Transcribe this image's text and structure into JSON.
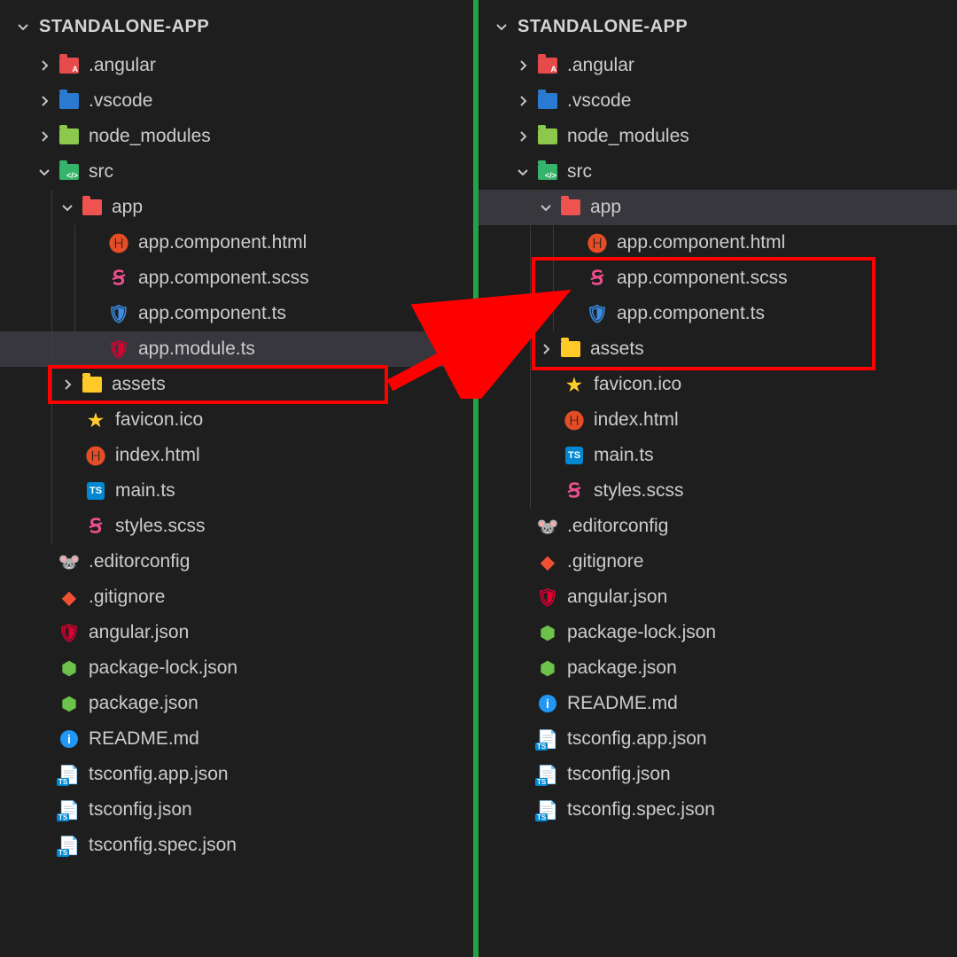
{
  "left": {
    "root": "STANDALONE-APP",
    "items": {
      "angular": ".angular",
      "vscode": ".vscode",
      "node": "node_modules",
      "src": "src",
      "app": "app",
      "comp_html": "app.component.html",
      "comp_scss": "app.component.scss",
      "comp_ts": "app.component.ts",
      "module_ts": "app.module.ts",
      "assets": "assets",
      "favicon": "favicon.ico",
      "index": "index.html",
      "main": "main.ts",
      "styles": "styles.scss",
      "editcfg": ".editorconfig",
      "gitignore": ".gitignore",
      "angjson": "angular.json",
      "pkglock": "package-lock.json",
      "pkg": "package.json",
      "readme": "README.md",
      "tscfgapp": "tsconfig.app.json",
      "tscfg": "tsconfig.json",
      "tscfgspec": "tsconfig.spec.json"
    }
  },
  "right": {
    "root": "STANDALONE-APP",
    "items": {
      "angular": ".angular",
      "vscode": ".vscode",
      "node": "node_modules",
      "src": "src",
      "app": "app",
      "comp_html": "app.component.html",
      "comp_scss": "app.component.scss",
      "comp_ts": "app.component.ts",
      "assets": "assets",
      "favicon": "favicon.ico",
      "index": "index.html",
      "main": "main.ts",
      "styles": "styles.scss",
      "editcfg": ".editorconfig",
      "gitignore": ".gitignore",
      "angjson": "angular.json",
      "pkglock": "package-lock.json",
      "pkg": "package.json",
      "readme": "README.md",
      "tscfgapp": "tsconfig.app.json",
      "tscfg": "tsconfig.json",
      "tscfgspec": "tsconfig.spec.json"
    }
  },
  "colors": {
    "highlight": "#ff0000",
    "divider": "#24a346"
  }
}
